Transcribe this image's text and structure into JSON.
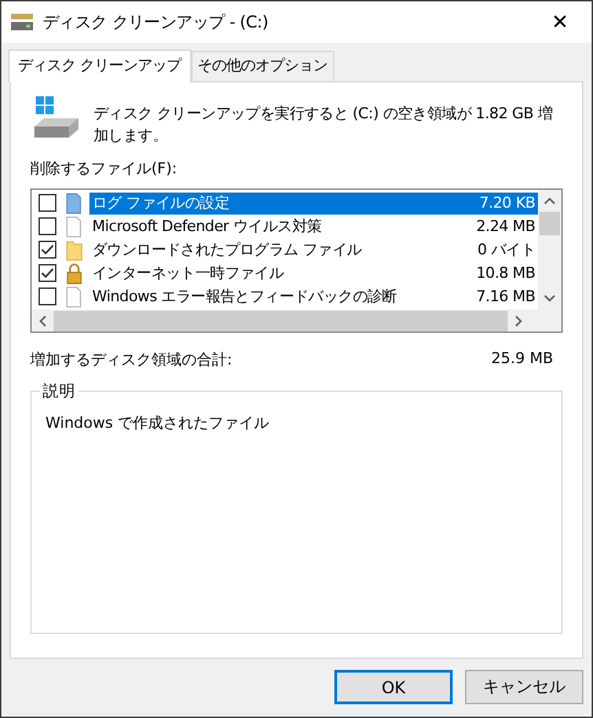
{
  "window": {
    "title": "ディスク クリーンアップ - (C:)",
    "close": "✕"
  },
  "tabs": [
    {
      "label": "ディスク クリーンアップ",
      "selected": true
    },
    {
      "label": "その他のオプション",
      "selected": false
    }
  ],
  "summary": "ディスク クリーンアップを実行すると (C:) の空き領域が 1.82 GB 増加します。",
  "files_label": "削除するファイル(F):",
  "files": [
    {
      "name": "ログ ファイルの設定",
      "size": "7.20 KB",
      "checked": false,
      "selected": true,
      "kind": "blue-doc"
    },
    {
      "name": "Microsoft Defender ウイルス対策",
      "size": "2.24 MB",
      "checked": false,
      "selected": false,
      "kind": "doc"
    },
    {
      "name": "ダウンロードされたプログラム ファイル",
      "size": "0 バイト",
      "checked": true,
      "selected": false,
      "kind": "folder"
    },
    {
      "name": "インターネット一時ファイル",
      "size": "10.8 MB",
      "checked": true,
      "selected": false,
      "kind": "lock"
    },
    {
      "name": "Windows エラー報告とフィードバックの診断",
      "size": "7.16 MB",
      "checked": false,
      "selected": false,
      "kind": "doc"
    }
  ],
  "total": {
    "label": "増加するディスク領域の合計:",
    "value": "25.9 MB"
  },
  "description": {
    "legend": "説明",
    "text": "Windows で作成されたファイル"
  },
  "buttons": [
    {
      "label": "OK",
      "default": true
    },
    {
      "label": "キャンセル",
      "default": false
    }
  ]
}
